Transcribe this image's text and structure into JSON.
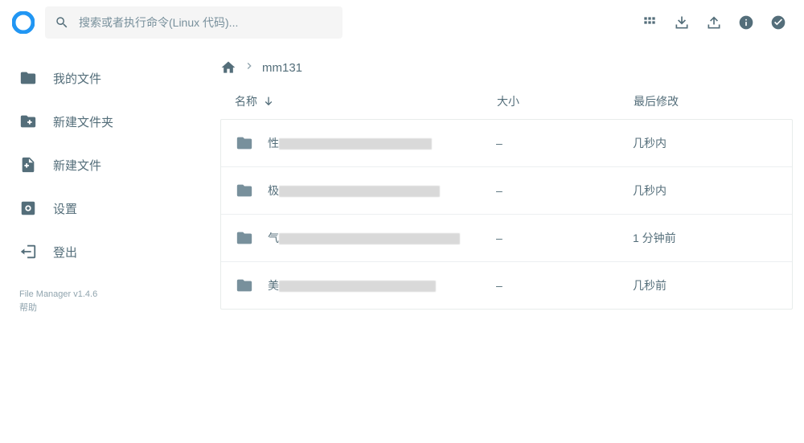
{
  "search": {
    "placeholder": "搜索或者执行命令(Linux 代码)..."
  },
  "sidebar": {
    "items": [
      {
        "label": "我的文件"
      },
      {
        "label": "新建文件夹"
      },
      {
        "label": "新建文件"
      },
      {
        "label": "设置"
      },
      {
        "label": "登出"
      }
    ],
    "footer_version": "File Manager v1.4.6",
    "footer_help": "帮助"
  },
  "breadcrumb": {
    "current": "mm131"
  },
  "columns": {
    "name": "名称",
    "size": "大小",
    "modified": "最后修改"
  },
  "rows": [
    {
      "name_prefix": "性",
      "size": "–",
      "modified": "几秒内"
    },
    {
      "name_prefix": "极",
      "size": "–",
      "modified": "几秒内"
    },
    {
      "name_prefix": "气",
      "size": "–",
      "modified": "1 分钟前"
    },
    {
      "name_prefix": "美",
      "size": "–",
      "modified": "几秒前"
    }
  ]
}
